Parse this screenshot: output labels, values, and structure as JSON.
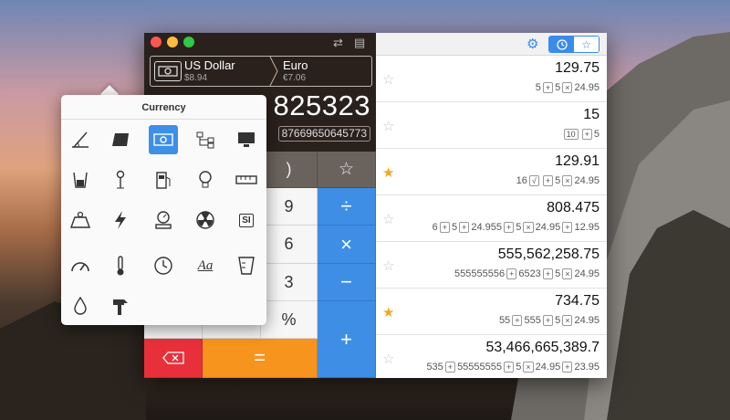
{
  "converter": {
    "from_name": "US Dollar",
    "from_value": "$8.94",
    "to_name": "Euro",
    "to_value": "€7.06"
  },
  "display": {
    "main": "825323",
    "sub": "87669650645773"
  },
  "keypad": {
    "close_paren": ")",
    "nine": "9",
    "six": "6",
    "three": "3",
    "percent": "%",
    "divide": "÷",
    "multiply": "×",
    "minus": "−",
    "plus": "+",
    "equals": "="
  },
  "history": [
    {
      "starred": false,
      "value": "129.75",
      "expr": [
        "5",
        "+",
        "5",
        "×",
        "24.95"
      ]
    },
    {
      "starred": false,
      "value": "15",
      "expr": [
        "10",
        "+",
        "5"
      ]
    },
    {
      "starred": true,
      "value": "129.91",
      "expr": [
        "16",
        "√",
        "+",
        "5",
        "×",
        "24.95"
      ]
    },
    {
      "starred": false,
      "value": "808.475",
      "expr": [
        "6",
        "+",
        "5",
        "+",
        "24.955",
        "+",
        "5",
        "×",
        "24.95",
        "+",
        "12.95"
      ]
    },
    {
      "starred": false,
      "value": "555,562,258.75",
      "expr": [
        "555555556",
        "+",
        "6523",
        "+",
        "5",
        "×",
        "24.95"
      ]
    },
    {
      "starred": true,
      "value": "734.75",
      "expr": [
        "55",
        "+",
        "555",
        "+",
        "5",
        "×",
        "24.95"
      ]
    },
    {
      "starred": false,
      "value": "53,466,665,389.7",
      "expr": [
        "535",
        "+",
        "55555555",
        "+",
        "5",
        "×",
        "24.95",
        "+",
        "23.95"
      ]
    }
  ],
  "popover": {
    "title": "Currency",
    "icons": [
      "angle-icon",
      "area-icon",
      "currency-icon",
      "network-icon",
      "computer-icon",
      "beaker-icon",
      "pendulum-icon",
      "fuel-pump-icon",
      "lightbulb-icon",
      "ruler-icon",
      "weight-icon",
      "lightning-icon",
      "scale-icon",
      "radiation-icon",
      "si-icon",
      "speedometer-icon",
      "thermometer-icon",
      "clock-icon",
      "typography-icon",
      "volume-icon",
      "drop-icon",
      "hammer-icon"
    ],
    "si_label": "SI",
    "typography_label": "Aa",
    "selected": "currency-icon"
  },
  "colors": {
    "accent": "#3d8fe8",
    "star": "#f4a81d",
    "delete": "#e8303a",
    "equals": "#f7941d"
  }
}
